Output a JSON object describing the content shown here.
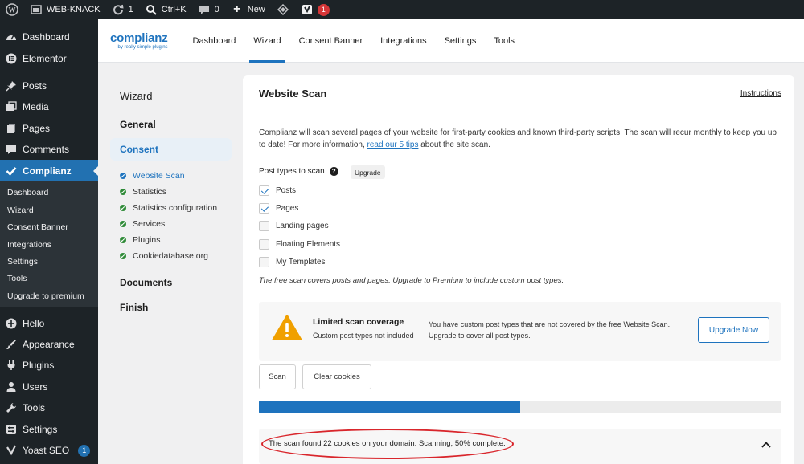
{
  "adminbar": {
    "site_name": "WEB-KNACK",
    "updates_count": "1",
    "search_shortcut": "Ctrl+K",
    "comments_count": "0",
    "new_label": "New",
    "yoast_notifications": "1"
  },
  "adminmenu": {
    "top_items": [
      {
        "label": "Dashboard",
        "icon": "dashboard-icon"
      },
      {
        "label": "Elementor",
        "icon": "elementor-icon"
      }
    ],
    "mid_items": [
      {
        "label": "Posts",
        "icon": "pin-icon"
      },
      {
        "label": "Media",
        "icon": "media-icon"
      },
      {
        "label": "Pages",
        "icon": "pages-icon"
      },
      {
        "label": "Comments",
        "icon": "comment-icon"
      },
      {
        "label": "Complianz",
        "icon": "check-icon"
      }
    ],
    "submenu": [
      "Dashboard",
      "Wizard",
      "Consent Banner",
      "Integrations",
      "Settings",
      "Tools",
      "Upgrade to premium"
    ],
    "bottom_items": [
      {
        "label": "Hello",
        "icon": "plus-icon"
      },
      {
        "label": "Appearance",
        "icon": "brush-icon"
      },
      {
        "label": "Plugins",
        "icon": "plug-icon"
      },
      {
        "label": "Users",
        "icon": "user-icon"
      },
      {
        "label": "Tools",
        "icon": "wrench-icon"
      },
      {
        "label": "Settings",
        "icon": "settings-icon"
      },
      {
        "label": "Yoast SEO",
        "icon": "yoast-icon",
        "badge": "1"
      }
    ]
  },
  "plugin_header": {
    "logo_main": "complianz",
    "logo_sub": "by really simple plugins",
    "tabs": [
      "Dashboard",
      "Wizard",
      "Consent Banner",
      "Integrations",
      "Settings",
      "Tools"
    ],
    "active_tab": "Wizard"
  },
  "wizard": {
    "title": "Wizard",
    "steps": {
      "general": "General",
      "consent": "Consent",
      "documents": "Documents",
      "finish": "Finish"
    },
    "consent_substeps": [
      "Website Scan",
      "Statistics",
      "Statistics configuration",
      "Services",
      "Plugins",
      "Cookiedatabase.org"
    ]
  },
  "scan": {
    "title": "Website Scan",
    "instructions_link": "Instructions",
    "intro_before": "Complianz will scan several pages of your website for first-party cookies and known third-party scripts. The scan will recur monthly to keep you up to date! For more information, ",
    "intro_link": "read our 5 tips",
    "intro_after": " about the site scan.",
    "post_types_label": "Post types to scan",
    "upgrade_pill": "Upgrade",
    "post_types": [
      {
        "label": "Posts",
        "checked": true
      },
      {
        "label": "Pages",
        "checked": true
      },
      {
        "label": "Landing pages",
        "checked": false
      },
      {
        "label": "Floating Elements",
        "checked": false
      },
      {
        "label": "My Templates",
        "checked": false
      }
    ],
    "free_note": "The free scan covers posts and pages. Upgrade to Premium to include custom post types.",
    "warning": {
      "title": "Limited scan coverage",
      "subtitle": "Custom post types not included",
      "description": "You have custom post types that are not covered by the free Website Scan. Upgrade to cover all post types.",
      "button": "Upgrade Now",
      "color": "#f0a000"
    },
    "scan_button": "Scan",
    "clear_button": "Clear cookies",
    "progress_fraction": 0.5,
    "result_text": "The scan found 22 cookies on your domain. Scanning, 50% complete.",
    "accent_color": "#1e73be"
  }
}
